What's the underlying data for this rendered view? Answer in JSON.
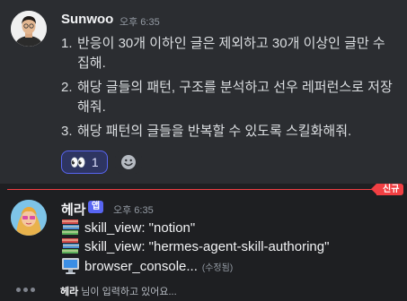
{
  "message1": {
    "author": "Sunwoo",
    "time": "오후 6:35",
    "items": [
      {
        "num": "1.",
        "text": "반응이 30개 이하인 글은 제외하고 30개 이상인 글만 수집해."
      },
      {
        "num": "2.",
        "text": "해당 글들의 패턴, 구조를 분석하고 선우 레퍼런스로 저장해줘."
      },
      {
        "num": "3.",
        "text": "해당 패턴의 글들을 반복할 수 있도록 스킬화해줘."
      }
    ],
    "reaction": {
      "emoji": "👀",
      "count": "1"
    }
  },
  "new_divider": {
    "label": "신규"
  },
  "message2": {
    "author": "헤라",
    "app_tag": "앱",
    "time": "오후 6:35",
    "tools": [
      {
        "icon": "books-icon",
        "text": "skill_view: \"notion\""
      },
      {
        "icon": "books-icon",
        "text": "skill_view: \"hermes-agent-skill-authoring\""
      },
      {
        "icon": "computer-icon",
        "text": "browser_console...",
        "edited": "(수정됨)"
      }
    ]
  },
  "typing": {
    "user": "헤라",
    "text": " 님이 입력하고 있어요..."
  }
}
